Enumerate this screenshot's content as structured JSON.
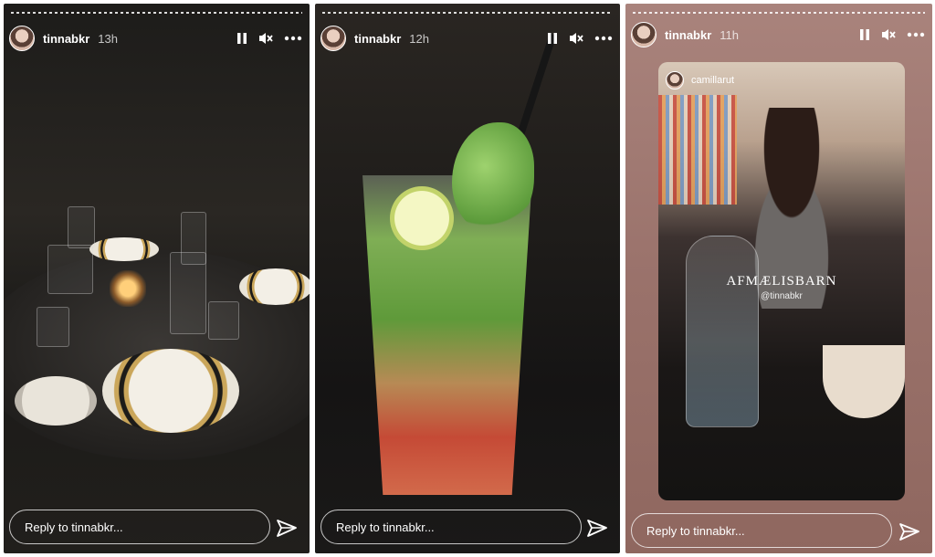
{
  "stories": [
    {
      "username": "tinnabkr",
      "time": "13h",
      "reply_placeholder": "Reply to tinnabkr...",
      "scene": "dining-table"
    },
    {
      "username": "tinnabkr",
      "time": "12h",
      "reply_placeholder": "Reply to tinnabkr...",
      "scene": "mojito-drink"
    },
    {
      "username": "tinnabkr",
      "time": "11h",
      "reply_placeholder": "Reply to tinnabkr...",
      "scene": "reposted-story",
      "mention": "camillarut",
      "sticker_title": "AFMÆLISBARN",
      "sticker_handle": "@tinnabkr"
    }
  ],
  "icons": {
    "pause": "pause-icon",
    "mute": "mute-icon",
    "more": "more-icon",
    "send": "send-icon"
  },
  "colors": {
    "text": "#ffffff",
    "story3_background": "#9e766f"
  }
}
